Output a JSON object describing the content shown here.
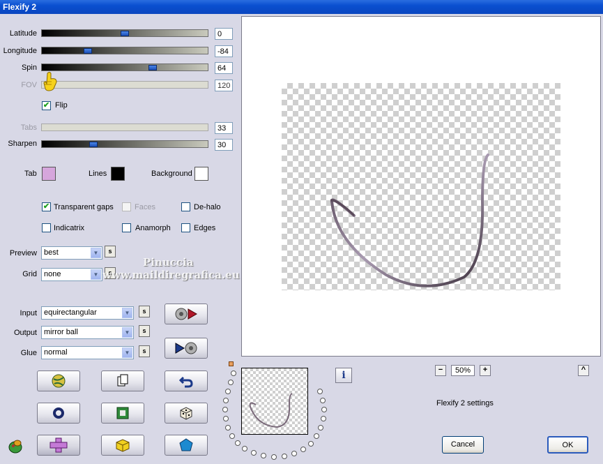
{
  "window": {
    "title": "Flexify 2"
  },
  "sliders": [
    {
      "label": "Latitude",
      "value": "0",
      "fraction": 0.5,
      "enabled": true
    },
    {
      "label": "Longitude",
      "value": "-84",
      "fraction": 0.27,
      "enabled": true
    },
    {
      "label": "Spin",
      "value": "64",
      "fraction": 0.66,
      "enabled": true
    },
    {
      "label": "FOV",
      "value": "120",
      "fraction": 0.0,
      "enabled": false
    }
  ],
  "flip": {
    "label": "Flip",
    "checked": true
  },
  "tabs_slider": {
    "label": "Tabs",
    "value": "33",
    "enabled": false
  },
  "sharpen_slider": {
    "label": "Sharpen",
    "value": "30",
    "fraction": 0.3
  },
  "colors": {
    "tab": {
      "label": "Tab",
      "color": "#d6a6dc"
    },
    "lines": {
      "label": "Lines",
      "color": "#000000"
    },
    "background": {
      "label": "Background",
      "color": "#ffffff"
    }
  },
  "options": {
    "transparent_gaps": {
      "label": "Transparent gaps",
      "checked": true
    },
    "faces": {
      "label": "Faces",
      "checked": false
    },
    "de_halo": {
      "label": "De-halo",
      "checked": false
    },
    "indicatrix": {
      "label": "Indicatrix",
      "checked": false
    },
    "anamorph": {
      "label": "Anamorph",
      "checked": false
    },
    "edges": {
      "label": "Edges",
      "checked": false
    }
  },
  "preview": {
    "label": "Preview",
    "value": "best",
    "s": "s"
  },
  "grid": {
    "label": "Grid",
    "value": "none",
    "s": "s"
  },
  "input": {
    "label": "Input",
    "value": "equirectangular",
    "s": "s"
  },
  "output": {
    "label": "Output",
    "value": "mirror ball",
    "s": "s"
  },
  "glue": {
    "label": "Glue",
    "value": "normal",
    "s": "s"
  },
  "watermark": {
    "line1": "Pinuccia",
    "line2": "www.maildiregrafica.eu"
  },
  "zoom": {
    "minus": "−",
    "value": "50%",
    "plus": "+",
    "up": "^"
  },
  "settings_label": "Flexify 2 settings",
  "info_label": "i",
  "buttons": {
    "cancel": "Cancel",
    "ok": "OK"
  },
  "icons": {
    "export": "export-icon",
    "import": "import-icon",
    "globe": "globe-icon",
    "copy": "copy-icon",
    "undo": "undo-icon",
    "ring": "ring-icon",
    "square": "square-icon",
    "dice": "dice-icon",
    "plugin": "plugin-icon",
    "cross": "cross-icon",
    "cube": "cube-icon",
    "pentagon": "pentagon-icon",
    "pointer": "hand-pointer-icon"
  }
}
